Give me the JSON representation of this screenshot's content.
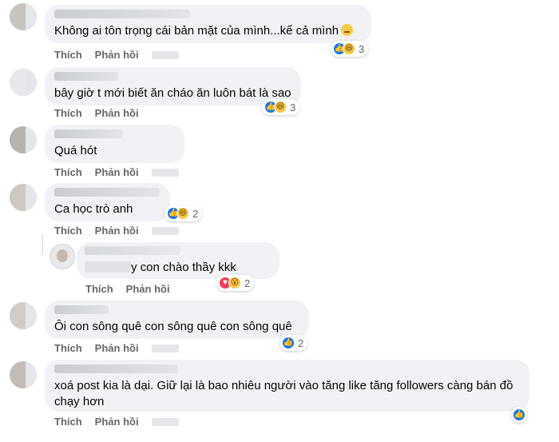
{
  "actions": {
    "like": "Thích",
    "reply": "Phản hồi"
  },
  "comments": [
    {
      "text": "Không ai tôn trọng cái bản mặt của mình...kể cả mình",
      "emoji": "grinning-sweat-emoji",
      "reactions": [
        "like",
        "haha"
      ],
      "count": "3"
    },
    {
      "text": "bây giờ t mới biết ăn cháo ăn luôn bát là sao",
      "reactions": [
        "like",
        "haha"
      ],
      "count": "3"
    },
    {
      "text": "Quá hót",
      "reactions": [],
      "count": ""
    },
    {
      "text": "Ca học trò anh",
      "reactions": [
        "like",
        "haha"
      ],
      "count": "2"
    },
    {
      "text": "y con chào thầy kkk",
      "reactions": [
        "love",
        "wow"
      ],
      "count": "2"
    },
    {
      "text": "Ôi con sông quê con sông quê con sông quê",
      "reactions": [
        "like"
      ],
      "count": "2"
    },
    {
      "text": "xoá post kia là dại. Giữ lại là bao nhiêu người vào tăng like tăng followers càng bán đồ chạy hơn",
      "reactions": [
        "like"
      ],
      "count": ""
    }
  ],
  "colors": {
    "bubble": "#f0f2f5",
    "like": "#1877f2",
    "haha": "#f7c948",
    "love": "#f33e58",
    "action_text": "#65676b"
  }
}
